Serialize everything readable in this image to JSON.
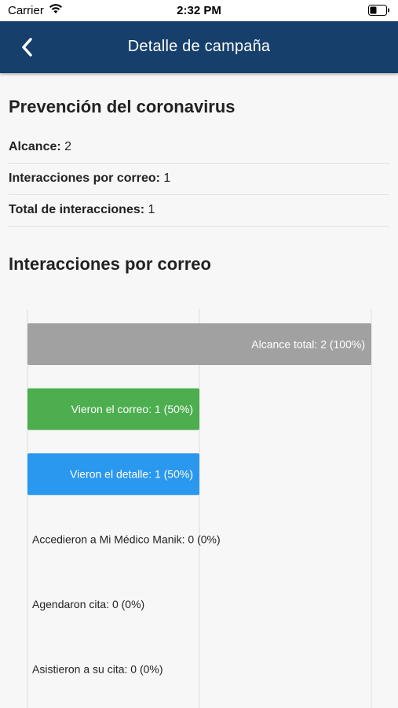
{
  "status_bar": {
    "carrier": "Carrier",
    "time": "2:32 PM"
  },
  "nav": {
    "title": "Detalle de campaña",
    "back_icon": "chevron-left-icon"
  },
  "campaign": {
    "name": "Prevención del coronavirus",
    "stats": [
      {
        "label": "Alcance:",
        "value": "2"
      },
      {
        "label": "Interacciones por correo:",
        "value": "1"
      },
      {
        "label": "Total de interacciones:",
        "value": "1"
      }
    ]
  },
  "section_title": "Interacciones por correo",
  "chart_data": {
    "type": "bar",
    "orientation": "horizontal",
    "xlim": [
      0,
      2
    ],
    "grid": true,
    "categories": [
      "Alcance total",
      "Vieron el correo",
      "Vieron el detalle",
      "Accedieron a Mi Médico Manik",
      "Agendaron cita",
      "Asistieron a su cita"
    ],
    "values": [
      2,
      1,
      1,
      0,
      0,
      0
    ],
    "labels": [
      "Alcance total: 2 (100%)",
      "Vieron el correo: 1 (50%)",
      "Vieron el detalle: 1 (50%)",
      "Accedieron a Mi Médico Manik: 0 (0%)",
      "Agendaron cita: 0 (0%)",
      "Asistieron a su cita: 0 (0%)"
    ],
    "colors": [
      "#a1a1a1",
      "#4cae4f",
      "#2b98f0",
      "#a1a1a1",
      "#a1a1a1",
      "#a1a1a1"
    ]
  }
}
